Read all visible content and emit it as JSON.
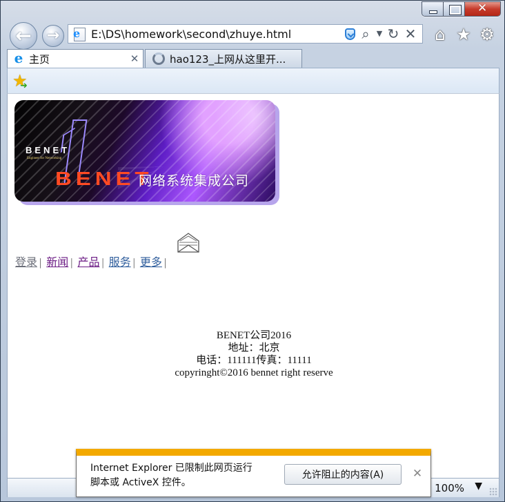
{
  "window": {
    "minimize_icon": "minimize-icon",
    "maximize_icon": "maximize-icon",
    "close_icon": "close-icon"
  },
  "toolbar": {
    "back_icon": "←",
    "forward_icon": "→",
    "address": "E:\\DS\\homework\\second\\zhuye.html",
    "search_icon": "⌕",
    "dropdown_icon": "▼",
    "refresh_icon": "↻",
    "stop_icon": "✕",
    "home_icon": "⌂",
    "favorites_icon": "★",
    "settings_icon": "⚙"
  },
  "tabs": [
    {
      "label": "主页",
      "close": "✕"
    },
    {
      "label": "hao123_上网从这里开..."
    }
  ],
  "page": {
    "banner": {
      "small_logo": "BENET",
      "tagline": "Engineer for Networking",
      "large_logo": "BENET",
      "company": "网络系统集成公司"
    },
    "links": [
      "登录",
      "新闻",
      "产品",
      "服务",
      "更多"
    ],
    "separator": "|",
    "footer": [
      "BENET公司2016",
      "地址：北京",
      "电话：111111传真：11111",
      "copyringht©2016 bennet right reserve"
    ]
  },
  "notification": {
    "message_line1": "Internet Explorer 已限制此网页运行",
    "message_line2": "脚本或 ActiveX 控件。",
    "button_label": "允许阻止的内容(A)",
    "close_icon": "✕"
  },
  "status": {
    "zoom": "100%",
    "dropdown_icon": "▼"
  },
  "colors": {
    "notification_accent": "#f3a900",
    "link": "#0000ee",
    "visited_link": "#6b1b84"
  }
}
